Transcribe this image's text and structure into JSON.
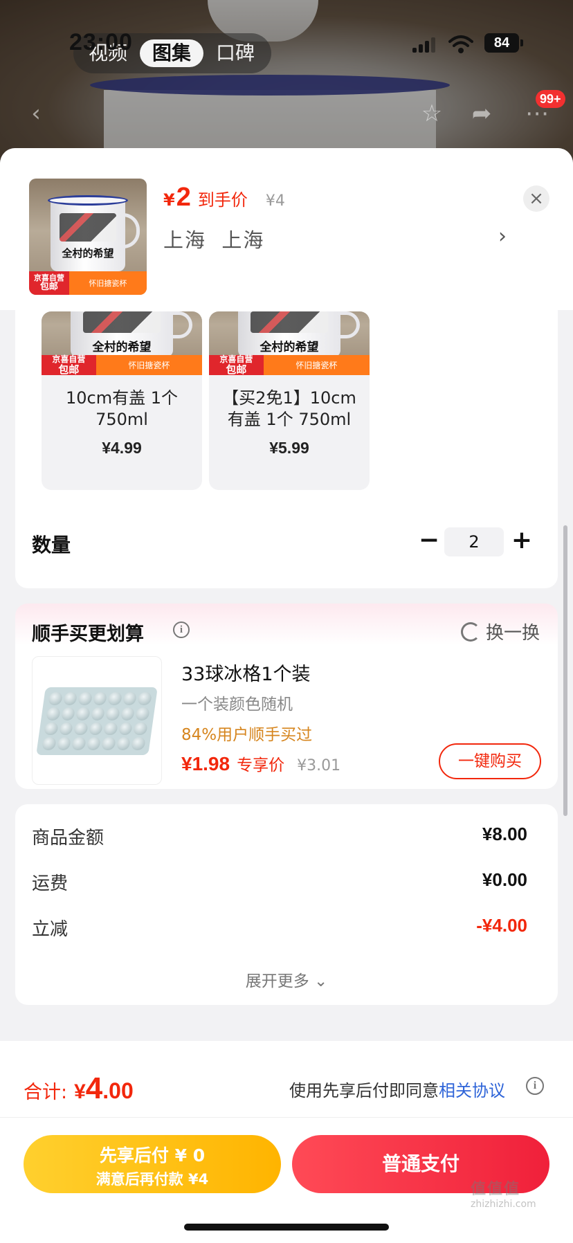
{
  "status": {
    "time": "23:00",
    "battery": "84"
  },
  "media_tabs": [
    {
      "label": "视频",
      "active": false
    },
    {
      "label": "图集",
      "active": true
    },
    {
      "label": "口碑",
      "active": false
    }
  ],
  "nav": {
    "cart_badge": "99+"
  },
  "header": {
    "price_symbol": "¥",
    "price_value": "2",
    "price_label": "到手价",
    "original_price": "¥4",
    "address": "上海  上海",
    "chevron": "›",
    "close": "×"
  },
  "product_image": {
    "cup_text": "全村的希望",
    "tag_line1": "京喜自营",
    "tag_line2": "包邮",
    "tag_label": "怀旧搪瓷杯"
  },
  "options": [
    {
      "name": "10cm有盖 1个 750ml",
      "price": "¥4.99"
    },
    {
      "name": "【买2免1】10cm有盖 1个 750ml",
      "price": "¥5.99"
    }
  ],
  "quantity": {
    "label": "数量",
    "value": "2",
    "minus": "−",
    "plus": "+"
  },
  "addon": {
    "title": "顺手买更划算",
    "refresh_label": "换一换",
    "product_name": "33球冰格1个装",
    "description": "一个装颜色随机",
    "social_proof": "84%用户顺手买过",
    "price": "¥1.98",
    "price_label": "专享价",
    "original_price": "¥3.01",
    "buy_label": "一键购买"
  },
  "summary": {
    "rows": [
      {
        "label": "商品金额",
        "value": "¥8.00"
      },
      {
        "label": "运费",
        "value": "¥0.00"
      },
      {
        "label": "立减",
        "value": "-¥4.00"
      }
    ],
    "expand_label": "展开更多 ⌄"
  },
  "bottom": {
    "total_label": "合计:",
    "total_symbol": "¥",
    "total_int": "4",
    "total_dec": ".00",
    "agree_text": "使用先享后付即同意",
    "agree_link": "相关协议",
    "later_line1": "先享后付 ¥ 0",
    "later_line2": "满意后再付款 ¥4",
    "pay_label": "普通支付"
  },
  "watermark": {
    "main": "值值值",
    "sub": "zhizhizhi.com"
  },
  "colors": {
    "accent_red": "#f2270c",
    "link_blue": "#2e64d8",
    "later_yellow": "#ffc21a",
    "addon_orange": "#d6851e"
  }
}
